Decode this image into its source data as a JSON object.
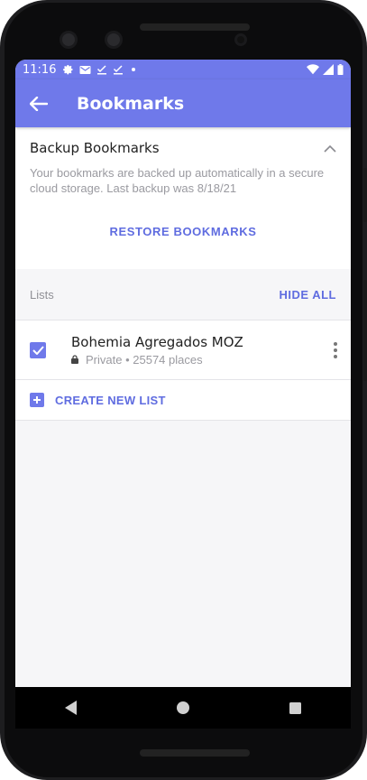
{
  "status_bar": {
    "time": "11:16"
  },
  "app_bar": {
    "title": "Bookmarks"
  },
  "backup": {
    "title": "Backup Bookmarks",
    "description": "Your bookmarks are backed up automatically in a secure cloud storage. Last backup was 8/18/21",
    "restore_label": "RESTORE BOOKMARKS"
  },
  "lists": {
    "label": "Lists",
    "hide_all_label": "HIDE ALL",
    "items": [
      {
        "name": "Bohemia Agregados MOZ",
        "privacy": "Private",
        "places": "25574 places",
        "checked": true
      }
    ],
    "create_label": "CREATE NEW LIST"
  },
  "colors": {
    "accent": "#6f79ea",
    "link": "#5f6ce0"
  }
}
